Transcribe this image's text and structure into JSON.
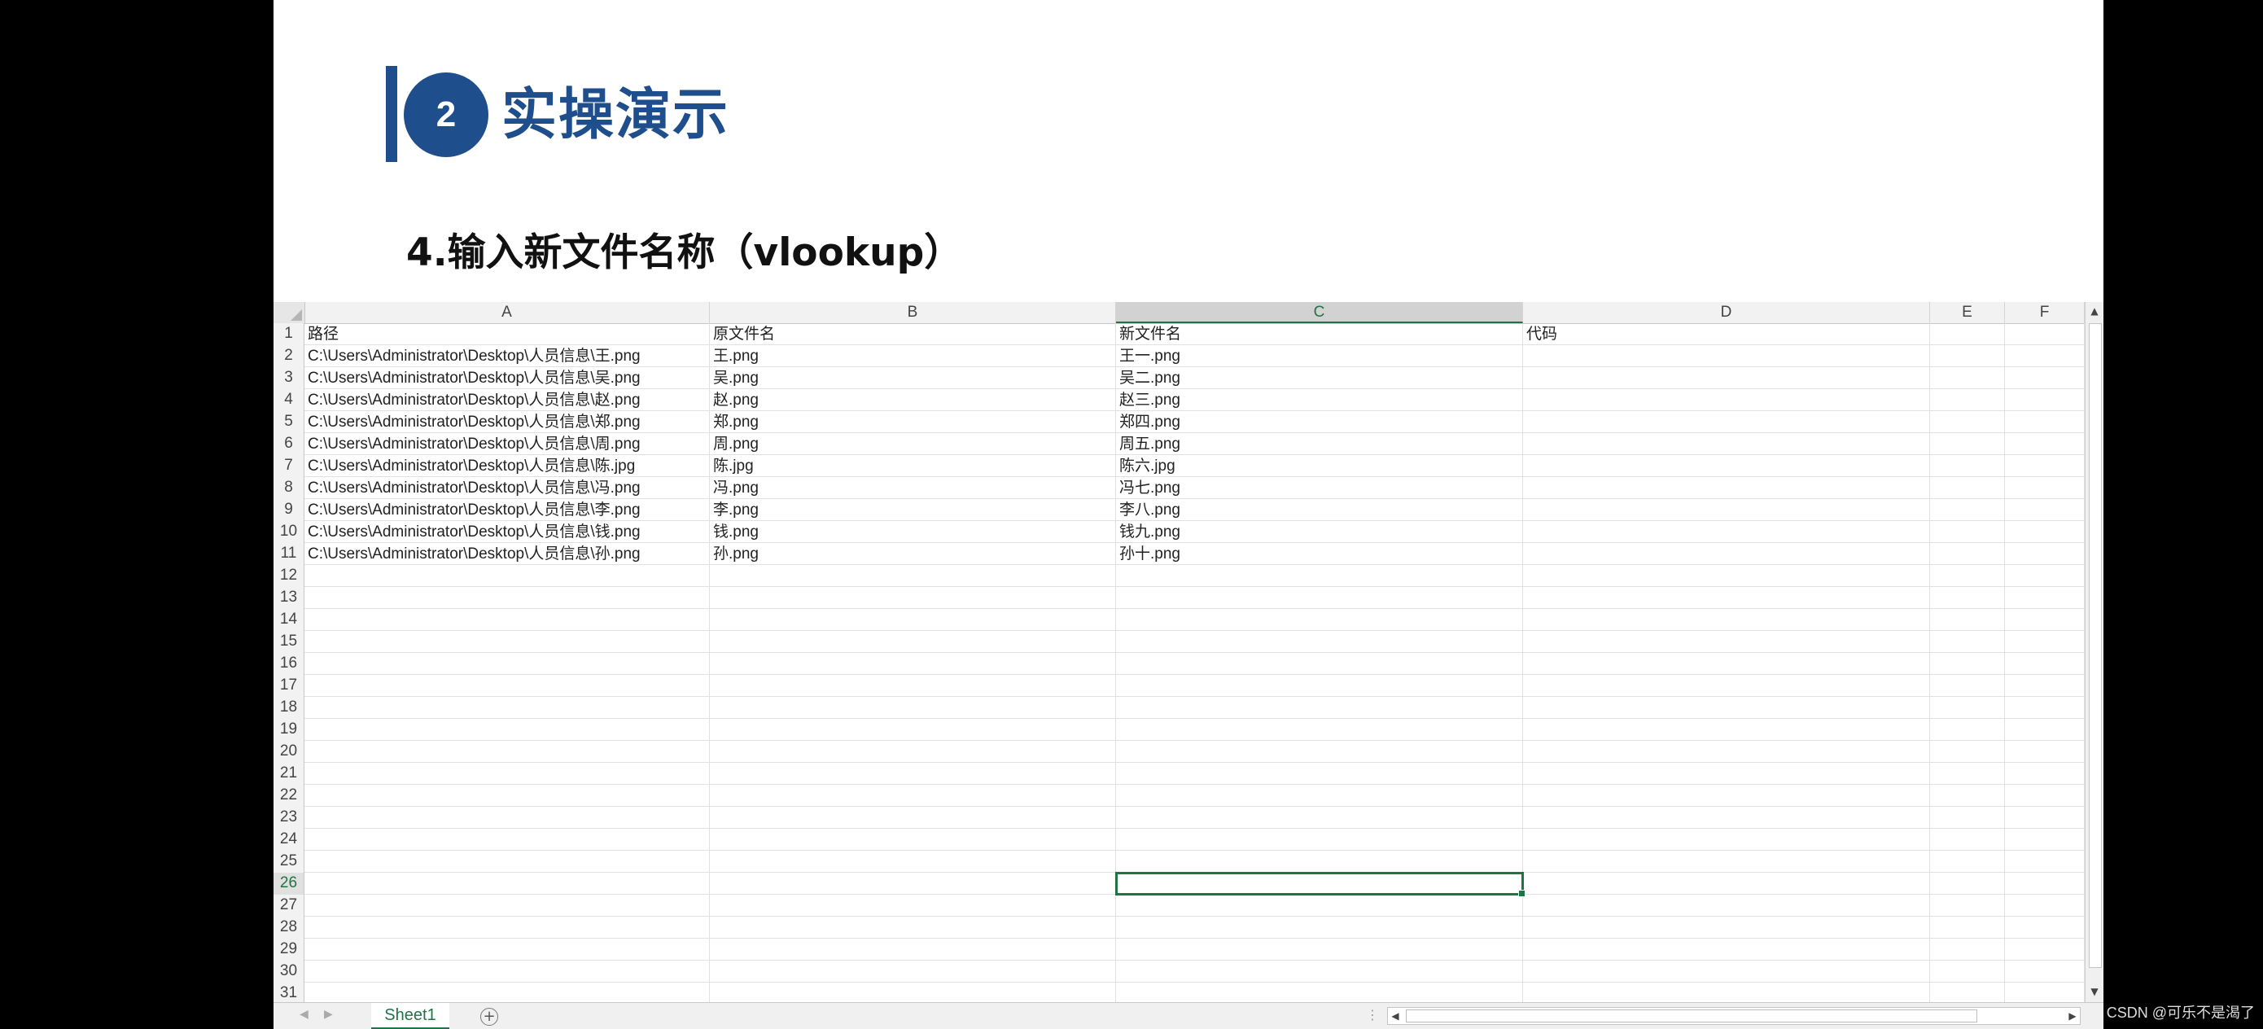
{
  "slide": {
    "section_number": "2",
    "section_title": "实操演示",
    "subtitle": "4.输入新文件名称（vlookup）"
  },
  "spreadsheet": {
    "columns": [
      "A",
      "B",
      "C",
      "D",
      "E",
      "F"
    ],
    "active_column": "C",
    "active_row": "26",
    "rows": [
      {
        "num": "1",
        "cells": [
          "路径",
          "原文件名",
          "新文件名",
          "代码"
        ]
      },
      {
        "num": "2",
        "cells": [
          "C:\\Users\\Administrator\\Desktop\\人员信息\\王.png",
          "王.png",
          "王一.png",
          ""
        ]
      },
      {
        "num": "3",
        "cells": [
          "C:\\Users\\Administrator\\Desktop\\人员信息\\吴.png",
          "吴.png",
          "吴二.png",
          ""
        ]
      },
      {
        "num": "4",
        "cells": [
          "C:\\Users\\Administrator\\Desktop\\人员信息\\赵.png",
          "赵.png",
          "赵三.png",
          ""
        ]
      },
      {
        "num": "5",
        "cells": [
          "C:\\Users\\Administrator\\Desktop\\人员信息\\郑.png",
          "郑.png",
          "郑四.png",
          ""
        ]
      },
      {
        "num": "6",
        "cells": [
          "C:\\Users\\Administrator\\Desktop\\人员信息\\周.png",
          "周.png",
          "周五.png",
          ""
        ]
      },
      {
        "num": "7",
        "cells": [
          "C:\\Users\\Administrator\\Desktop\\人员信息\\陈.jpg",
          "陈.jpg",
          "陈六.jpg",
          ""
        ]
      },
      {
        "num": "8",
        "cells": [
          "C:\\Users\\Administrator\\Desktop\\人员信息\\冯.png",
          "冯.png",
          "冯七.png",
          ""
        ]
      },
      {
        "num": "9",
        "cells": [
          "C:\\Users\\Administrator\\Desktop\\人员信息\\李.png",
          "李.png",
          "李八.png",
          ""
        ]
      },
      {
        "num": "10",
        "cells": [
          "C:\\Users\\Administrator\\Desktop\\人员信息\\钱.png",
          "钱.png",
          "钱九.png",
          ""
        ]
      },
      {
        "num": "11",
        "cells": [
          "C:\\Users\\Administrator\\Desktop\\人员信息\\孙.png",
          "孙.png",
          "孙十.png",
          ""
        ]
      },
      {
        "num": "12",
        "cells": []
      },
      {
        "num": "13",
        "cells": []
      },
      {
        "num": "14",
        "cells": []
      },
      {
        "num": "15",
        "cells": []
      },
      {
        "num": "16",
        "cells": []
      },
      {
        "num": "17",
        "cells": []
      },
      {
        "num": "18",
        "cells": []
      },
      {
        "num": "19",
        "cells": []
      },
      {
        "num": "20",
        "cells": []
      },
      {
        "num": "21",
        "cells": []
      },
      {
        "num": "22",
        "cells": []
      },
      {
        "num": "23",
        "cells": []
      },
      {
        "num": "24",
        "cells": []
      },
      {
        "num": "25",
        "cells": []
      },
      {
        "num": "26",
        "cells": []
      },
      {
        "num": "27",
        "cells": []
      },
      {
        "num": "28",
        "cells": []
      },
      {
        "num": "29",
        "cells": []
      },
      {
        "num": "30",
        "cells": []
      },
      {
        "num": "31",
        "cells": []
      }
    ],
    "sheet_tab": "Sheet1",
    "add_sheet_icon": "plus-circle-icon"
  },
  "watermark": "CSDN @可乐不是渴了",
  "colors": {
    "brand_blue": "#1f4e8c",
    "excel_green": "#217346"
  }
}
